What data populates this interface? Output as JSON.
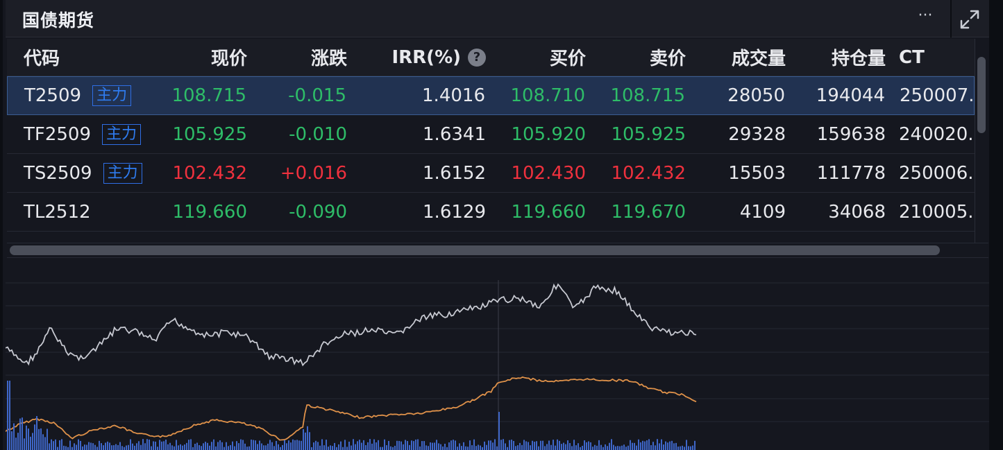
{
  "panel": {
    "title": "国债期货",
    "more_label": "···"
  },
  "columns": {
    "code": "代码",
    "price": "现价",
    "change": "涨跌",
    "irr": "IRR(%)",
    "bid": "买价",
    "ask": "卖价",
    "volume": "成交量",
    "open_interest": "持仓量",
    "ct": "CT"
  },
  "rows": [
    {
      "code": "T2509",
      "badge": "主力",
      "price": "108.715",
      "change": "-0.015",
      "irr": "1.4016",
      "bid": "108.710",
      "ask": "108.715",
      "volume": "28050",
      "open_interest": "194044",
      "ct": "250007.",
      "direction": "down"
    },
    {
      "code": "TF2509",
      "badge": "主力",
      "price": "105.925",
      "change": "-0.010",
      "irr": "1.6341",
      "bid": "105.920",
      "ask": "105.925",
      "volume": "29328",
      "open_interest": "159638",
      "ct": "240020.",
      "direction": "down"
    },
    {
      "code": "TS2509",
      "badge": "主力",
      "price": "102.432",
      "change": "+0.016",
      "irr": "1.6152",
      "bid": "102.430",
      "ask": "102.432",
      "volume": "15503",
      "open_interest": "111778",
      "ct": "250006.",
      "direction": "up"
    },
    {
      "code": "TL2512",
      "badge": "",
      "price": "119.660",
      "change": "-0.090",
      "irr": "1.6129",
      "bid": "119.660",
      "ask": "119.670",
      "volume": "4109",
      "open_interest": "34068",
      "ct": "210005.",
      "direction": "down"
    }
  ],
  "colors": {
    "up": "#f0313e",
    "down": "#2ebd68",
    "price_line": "#c7c9d1",
    "avg_line": "#e0924a",
    "volume_bar": "#3f67c9",
    "badge": "#2f7cf0"
  },
  "icons": {
    "more": "more-dots-icon",
    "expand": "expand-icon",
    "help": "help-icon"
  }
}
